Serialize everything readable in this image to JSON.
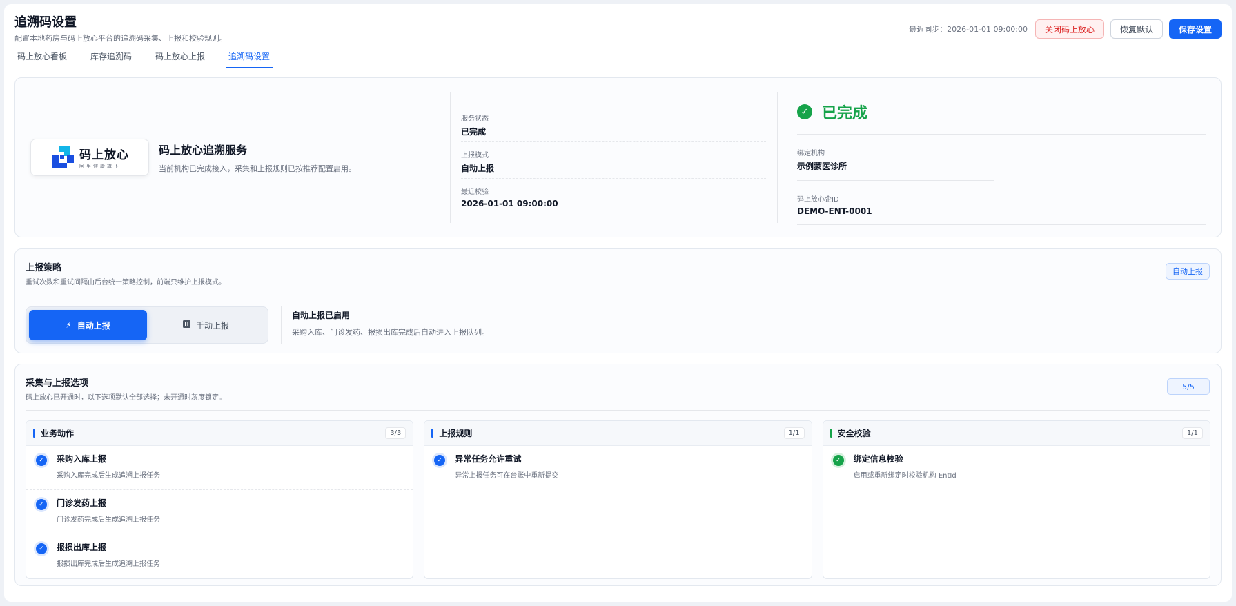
{
  "header": {
    "title": "追溯码设置",
    "subtitle": "配置本地药房与码上放心平台的追溯码采集、上报和校验规则。",
    "sync_label": "最近同步：2026-01-01 09:00:00",
    "close_button": "关闭码上放心",
    "reset_button": "恢复默认",
    "save_button": "保存设置"
  },
  "tabs": [
    {
      "label": "码上放心看板",
      "active": false
    },
    {
      "label": "库存追溯码",
      "active": false
    },
    {
      "label": "码上放心上报",
      "active": false
    },
    {
      "label": "追溯码设置",
      "active": true
    }
  ],
  "service": {
    "logo_text": "码上放心",
    "logo_small": "阿里健康旗下",
    "name": "码上放心追溯服务",
    "desc": "当前机构已完成接入，采集和上报规则已按推荐配置启用。",
    "status_label": "服务状态",
    "status_value": "已完成",
    "mode_label": "上报模式",
    "mode_value": "自动上报",
    "check_label": "最近校验",
    "check_value": "2026-01-01 09:00:00",
    "big_status": "已完成",
    "org_label": "绑定机构",
    "org_value": "示例蒙医诊所",
    "id_label": "码上放心企ID",
    "id_value": "DEMO-ENT-0001",
    "status_color": "#16a34a"
  },
  "strategy": {
    "title": "上报策略",
    "subtitle": "重试次数和重试间隔由后台统一策略控制，前端只维护上报模式。",
    "tag": "自动上报",
    "auto_label": "自动上报",
    "manual_label": "手动上报",
    "desc_title": "自动上报已启用",
    "desc_text": "采购入库、门诊发药、报损出库完成后自动进入上报队列。"
  },
  "options": {
    "title": "采集与上报选项",
    "subtitle": "码上放心已开通时，以下选项默认全部选择；未开通时灰度锁定。",
    "tag": "5/5",
    "columns": [
      {
        "title": "业务动作",
        "count": "3/3",
        "color": "#1565f5",
        "items": [
          {
            "title": "采购入库上报",
            "desc": "采购入库完成后生成追溯上报任务"
          },
          {
            "title": "门诊发药上报",
            "desc": "门诊发药完成后生成追溯上报任务"
          },
          {
            "title": "报损出库上报",
            "desc": "报损出库完成后生成追溯上报任务"
          }
        ]
      },
      {
        "title": "上报规则",
        "count": "1/1",
        "color": "#1565f5",
        "items": [
          {
            "title": "异常任务允许重试",
            "desc": "异常上报任务可在台账中重新提交"
          }
        ]
      },
      {
        "title": "安全校验",
        "count": "1/1",
        "color": "#16a34a",
        "items": [
          {
            "title": "绑定信息校验",
            "desc": "启用或重新绑定时校验机构 EntId"
          }
        ]
      }
    ]
  },
  "colors": {
    "primary": "#1565f5",
    "success": "#16a34a",
    "danger": "#dc2626"
  }
}
